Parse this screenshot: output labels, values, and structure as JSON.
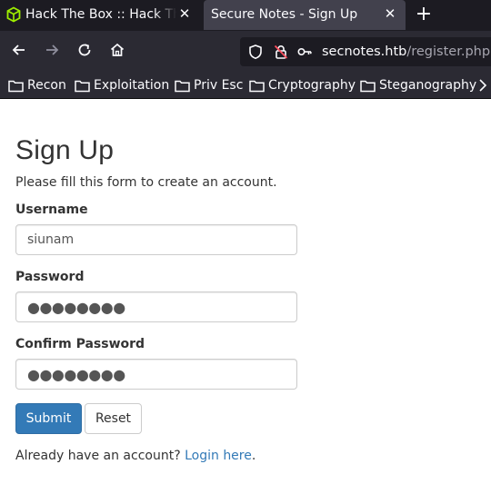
{
  "browser": {
    "tabs": [
      {
        "title": "Hack The Box :: Hack The Box",
        "close": "✕",
        "active": false
      },
      {
        "title": "Secure Notes - Sign Up",
        "close": "✕",
        "active": true
      }
    ],
    "new_tab": "+",
    "url": {
      "host": "secnotes.htb",
      "path": "/register.php"
    },
    "bookmarks": [
      "Recon",
      "Exploitation",
      "Priv Esc",
      "Cryptography",
      "Steganography"
    ],
    "colors": {
      "chrome_bg": "#1c1b22",
      "toolbar_bg": "#2b2a33",
      "active_tab": "#42414d"
    }
  },
  "page": {
    "heading": "Sign Up",
    "intro": "Please fill this form to create an account.",
    "form": {
      "username_label": "Username",
      "username_value": "siunam",
      "password_label": "Password",
      "password_value": "●●●●●●●●",
      "confirm_label": "Confirm Password",
      "confirm_value": "●●●●●●●●",
      "submit_label": "Submit",
      "reset_label": "Reset"
    },
    "login_prompt": "Already have an account?",
    "login_link": "Login here",
    "login_suffix": ".",
    "colors": {
      "primary": "#337ab7",
      "text": "#333333"
    }
  }
}
